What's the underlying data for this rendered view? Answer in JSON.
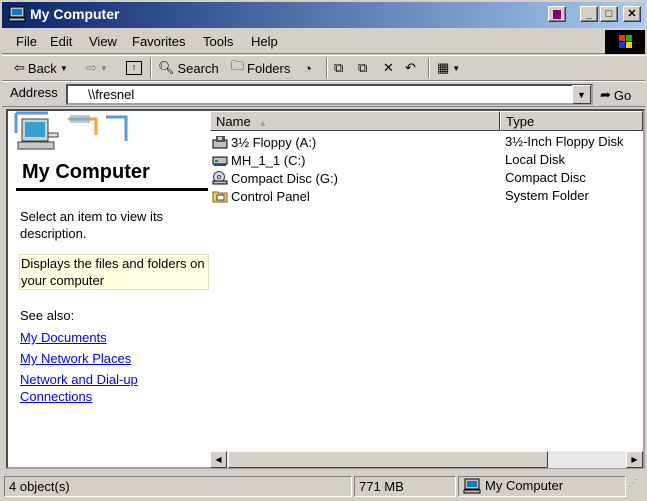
{
  "window": {
    "title": "My Computer"
  },
  "menu": [
    "File",
    "Edit",
    "View",
    "Favorites",
    "Tools",
    "Help"
  ],
  "toolbar": {
    "back": "Back",
    "search": "Search",
    "folders": "Folders"
  },
  "address": {
    "label": "Address",
    "value": "\\\\fresnel",
    "go": "Go"
  },
  "panel": {
    "title": "My Computer",
    "description": "Select an item to view its description.",
    "info": "Displays the files and folders on your computer",
    "see_also": "See also:",
    "links": [
      "My Documents",
      "My Network Places",
      "Network and Dial-up Connections"
    ]
  },
  "list": {
    "columns": [
      "Name",
      "Type"
    ],
    "rows": [
      {
        "name": "3½ Floppy (A:)",
        "type": "3½-Inch Floppy Disk",
        "icon": "floppy-icon"
      },
      {
        "name": "MH_1_1 (C:)",
        "type": "Local Disk",
        "icon": "hard-disk-icon"
      },
      {
        "name": "Compact Disc (G:)",
        "type": "Compact Disc",
        "icon": "cd-icon"
      },
      {
        "name": "Control Panel",
        "type": "System Folder",
        "icon": "control-panel-icon"
      }
    ]
  },
  "status": {
    "objects": "4 object(s)",
    "size": "771 MB",
    "zone": "My Computer"
  }
}
